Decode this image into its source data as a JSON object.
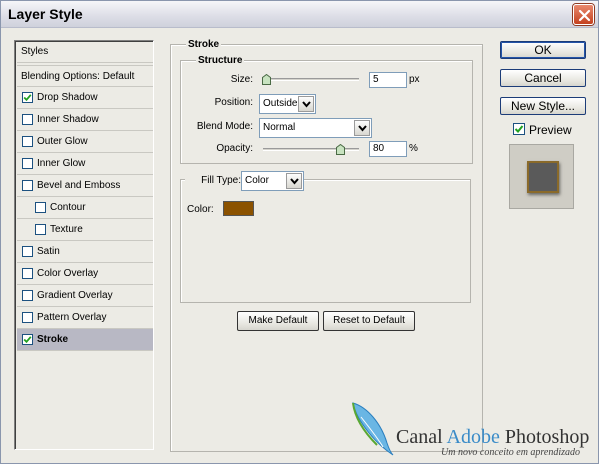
{
  "window": {
    "title": "Layer Style"
  },
  "styles_list": {
    "header_styles": "Styles",
    "header_blending": "Blending Options: Default",
    "items": [
      {
        "label": "Drop Shadow",
        "checked": true,
        "indent": false,
        "selected": false
      },
      {
        "label": "Inner Shadow",
        "checked": false,
        "indent": false,
        "selected": false
      },
      {
        "label": "Outer Glow",
        "checked": false,
        "indent": false,
        "selected": false
      },
      {
        "label": "Inner Glow",
        "checked": false,
        "indent": false,
        "selected": false
      },
      {
        "label": "Bevel and Emboss",
        "checked": false,
        "indent": false,
        "selected": false
      },
      {
        "label": "Contour",
        "checked": false,
        "indent": true,
        "selected": false
      },
      {
        "label": "Texture",
        "checked": false,
        "indent": true,
        "selected": false
      },
      {
        "label": "Satin",
        "checked": false,
        "indent": false,
        "selected": false
      },
      {
        "label": "Color Overlay",
        "checked": false,
        "indent": false,
        "selected": false
      },
      {
        "label": "Gradient Overlay",
        "checked": false,
        "indent": false,
        "selected": false
      },
      {
        "label": "Pattern Overlay",
        "checked": false,
        "indent": false,
        "selected": false
      },
      {
        "label": "Stroke",
        "checked": true,
        "indent": false,
        "selected": true
      }
    ]
  },
  "stroke": {
    "group_title": "Stroke",
    "structure_title": "Structure",
    "size_label": "Size:",
    "size_value": "5",
    "size_unit": "px",
    "position_label": "Position:",
    "position_value": "Outside",
    "blend_mode_label": "Blend Mode:",
    "blend_mode_value": "Normal",
    "opacity_label": "Opacity:",
    "opacity_value": "80",
    "opacity_unit": "%",
    "fill_type_label": "Fill Type:",
    "fill_type_value": "Color",
    "color_label": "Color:",
    "color_value": "#8b5200",
    "make_default_label": "Make Default",
    "reset_default_label": "Reset to Default"
  },
  "buttons": {
    "ok": "OK",
    "cancel": "Cancel",
    "new_style": "New Style...",
    "preview": "Preview",
    "preview_checked": true
  },
  "watermark": {
    "brand_a": "Canal ",
    "brand_b": "Adobe",
    "brand_c": " Photoshop",
    "tagline": "Um novo conceito em aprendizado"
  },
  "colors": {
    "accent_blue": "#2454a8",
    "selected_row": "#b8b8c4",
    "stroke_color": "#8b5200"
  }
}
